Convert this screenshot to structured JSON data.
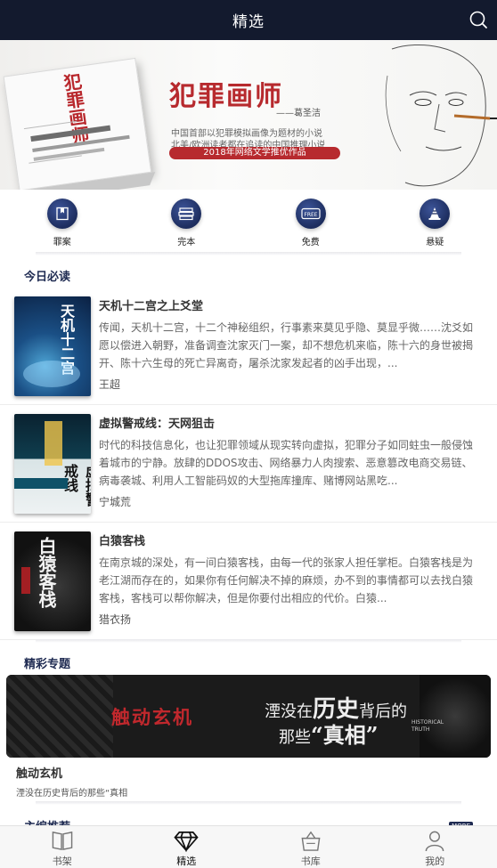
{
  "header": {
    "title": "精选",
    "search_icon": "search-icon"
  },
  "banner": {
    "title": "犯罪画师",
    "author": "——葛圣洁",
    "line1": "中国首部以犯罪模拟画像为题材的小说",
    "line2": "北美/欧洲读者都在追读的中国推理小说",
    "tag": "2018年网络文学推优作品",
    "book_spine": "犯罪画师",
    "active_dot": 0,
    "dot_count": 3
  },
  "categories": [
    {
      "label": "罪案",
      "icon": "book-icon"
    },
    {
      "label": "完本",
      "icon": "stack-icon"
    },
    {
      "label": "免费",
      "icon": "free-icon"
    },
    {
      "label": "悬疑",
      "icon": "cone-icon"
    }
  ],
  "today": {
    "title": "今日必读",
    "items": [
      {
        "title": "天机十二宫之上爻堂",
        "desc": "传闻，天机十二宫，十二个神秘组织，行事素来莫见乎隐、莫显乎微……沈爻如愿以偿进入朝野，准备调查沈家灭门一案，却不想危机来临，陈十六的身世被揭开、陈十六生母的死亡异离奇，屠杀沈家发起者的凶手出现，...",
        "author": "王超",
        "cover_text": "天机十二宫"
      },
      {
        "title": "虚拟警戒线：天网狙击",
        "desc": "时代的科技信息化，也让犯罪领域从现实转向虚拟，犯罪分子如同蛀虫一般侵蚀着城市的宁静。放肆的DDOS攻击、网络暴力人肉搜索、恶意篡改电商交易链、病毒袭城、利用人工智能码奴的大型拖库撞库、赌博网站黑吃...",
        "author": "宁城荒",
        "cover_text": "虚拟警戒线"
      },
      {
        "title": "白猿客栈",
        "desc": "在南京城的深处，有一间白猿客栈，由每一代的张家人担任掌柜。白猿客栈是为老江湖而存在的，如果你有任何解决不掉的麻烦，办不到的事情都可以去找白猿客栈，客栈可以帮你解决，但是你要付出相应的代价。白猿...",
        "author": "猎衣扬",
        "cover_text": "白猿客栈"
      }
    ]
  },
  "topics": {
    "title": "精彩专题",
    "banner_red": "触动玄机",
    "banner_line1": "湮没在",
    "banner_big": "历史",
    "banner_line1b": "背后的",
    "banner_line2": "那些",
    "banner_big2": "“真相”",
    "banner_en": "HISTORICAL TRUTH",
    "item_title": "触动玄机",
    "item_sub": "湮没在历史背后的那些“真相"
  },
  "editor": {
    "title": "主编推荐",
    "more": "MORE"
  },
  "tabs": [
    {
      "label": "书架",
      "icon": "bookshelf-icon"
    },
    {
      "label": "精选",
      "icon": "diamond-icon",
      "active": true
    },
    {
      "label": "书库",
      "icon": "bag-icon"
    },
    {
      "label": "我的",
      "icon": "person-icon"
    }
  ]
}
